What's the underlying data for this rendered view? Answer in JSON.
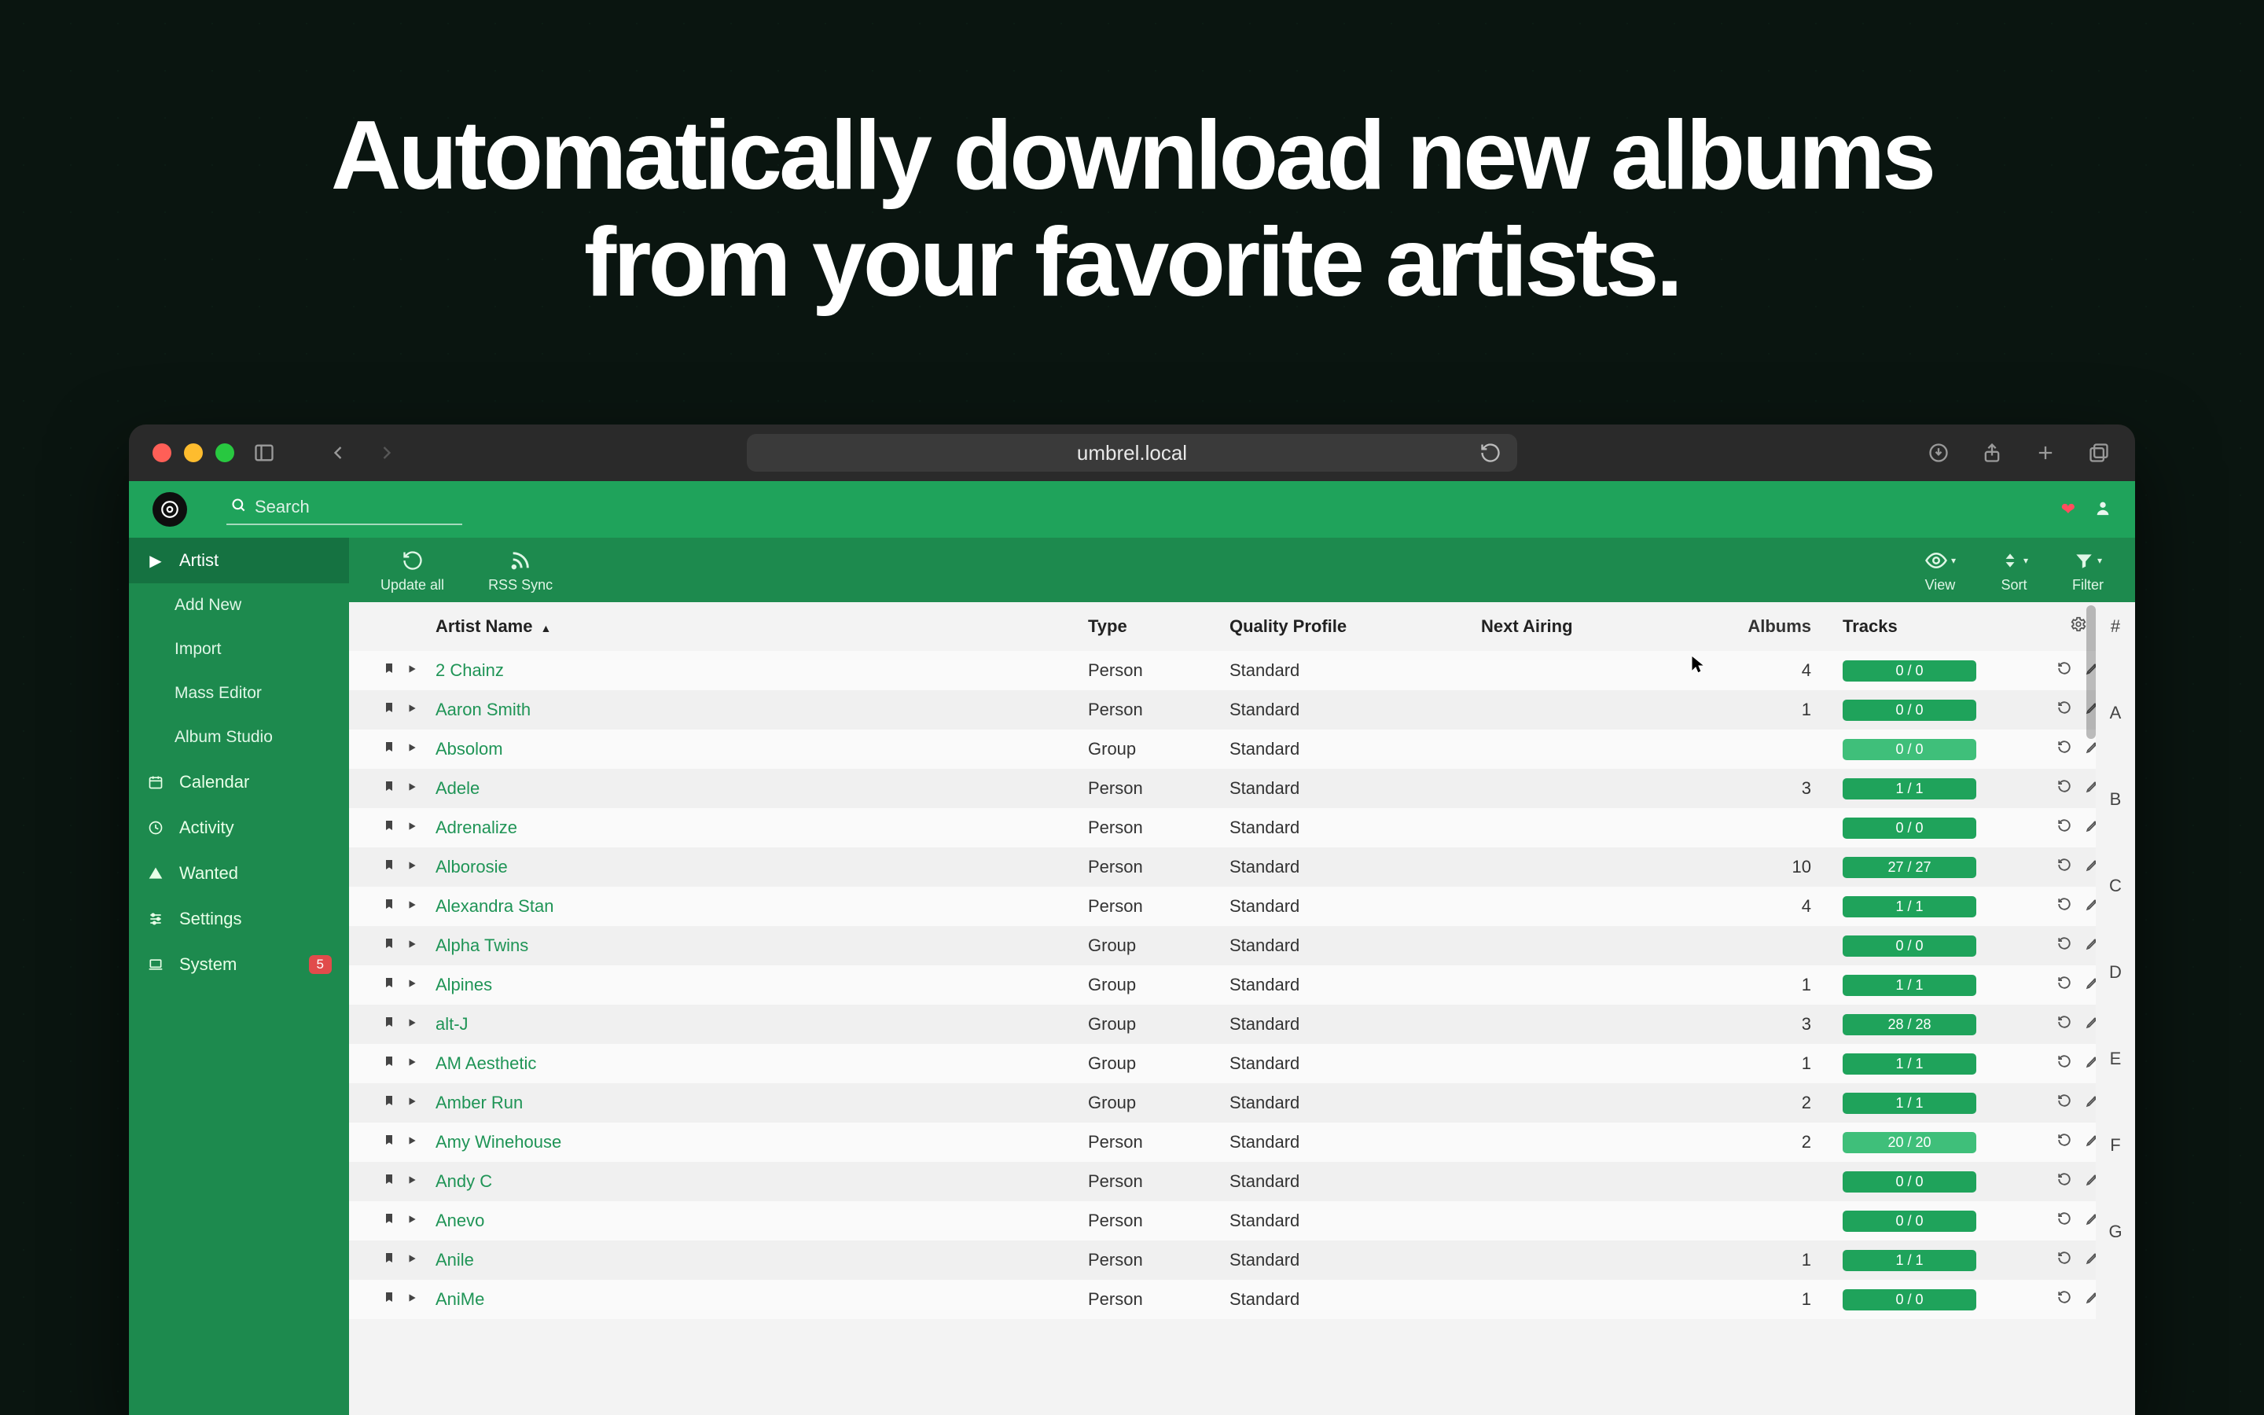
{
  "hero": {
    "line1": "Automatically download new albums",
    "line2": "from your favorite artists."
  },
  "browser": {
    "url": "umbrel.local"
  },
  "header": {
    "search_placeholder": "Search"
  },
  "sidebar": {
    "artist": "Artist",
    "sub": {
      "add_new": "Add New",
      "import": "Import",
      "mass_editor": "Mass Editor",
      "album_studio": "Album Studio"
    },
    "calendar": "Calendar",
    "activity": "Activity",
    "wanted": "Wanted",
    "settings": "Settings",
    "system": "System",
    "system_badge": "5"
  },
  "toolbar": {
    "update_all": "Update all",
    "rss_sync": "RSS Sync",
    "view": "View",
    "sort": "Sort",
    "filter": "Filter"
  },
  "columns": {
    "artist_name": "Artist Name",
    "type": "Type",
    "quality_profile": "Quality Profile",
    "next_airing": "Next Airing",
    "albums": "Albums",
    "tracks": "Tracks"
  },
  "alpha": [
    "#",
    "A",
    "B",
    "C",
    "D",
    "E",
    "F",
    "G"
  ],
  "rows": [
    {
      "name": "2 Chainz",
      "type": "Person",
      "quality": "Standard",
      "albums": "4",
      "tracks": "0 / 0",
      "pill": "std"
    },
    {
      "name": "Aaron Smith",
      "type": "Person",
      "quality": "Standard",
      "albums": "1",
      "tracks": "0 / 0",
      "pill": "std"
    },
    {
      "name": "Absolom",
      "type": "Group",
      "quality": "Standard",
      "albums": "",
      "tracks": "0 / 0",
      "pill": "alt"
    },
    {
      "name": "Adele",
      "type": "Person",
      "quality": "Standard",
      "albums": "3",
      "tracks": "1 / 1",
      "pill": "std"
    },
    {
      "name": "Adrenalize",
      "type": "Person",
      "quality": "Standard",
      "albums": "",
      "tracks": "0 / 0",
      "pill": "std"
    },
    {
      "name": "Alborosie",
      "type": "Person",
      "quality": "Standard",
      "albums": "10",
      "tracks": "27 / 27",
      "pill": "std"
    },
    {
      "name": "Alexandra Stan",
      "type": "Person",
      "quality": "Standard",
      "albums": "4",
      "tracks": "1 / 1",
      "pill": "std"
    },
    {
      "name": "Alpha Twins",
      "type": "Group",
      "quality": "Standard",
      "albums": "",
      "tracks": "0 / 0",
      "pill": "std"
    },
    {
      "name": "Alpines",
      "type": "Group",
      "quality": "Standard",
      "albums": "1",
      "tracks": "1 / 1",
      "pill": "std"
    },
    {
      "name": "alt-J",
      "type": "Group",
      "quality": "Standard",
      "albums": "3",
      "tracks": "28 / 28",
      "pill": "std"
    },
    {
      "name": "AM Aesthetic",
      "type": "Group",
      "quality": "Standard",
      "albums": "1",
      "tracks": "1 / 1",
      "pill": "std"
    },
    {
      "name": "Amber Run",
      "type": "Group",
      "quality": "Standard",
      "albums": "2",
      "tracks": "1 / 1",
      "pill": "std"
    },
    {
      "name": "Amy Winehouse",
      "type": "Person",
      "quality": "Standard",
      "albums": "2",
      "tracks": "20 / 20",
      "pill": "alt"
    },
    {
      "name": "Andy C",
      "type": "Person",
      "quality": "Standard",
      "albums": "",
      "tracks": "0 / 0",
      "pill": "std"
    },
    {
      "name": "Anevo",
      "type": "Person",
      "quality": "Standard",
      "albums": "",
      "tracks": "0 / 0",
      "pill": "std"
    },
    {
      "name": "Anile",
      "type": "Person",
      "quality": "Standard",
      "albums": "1",
      "tracks": "1 / 1",
      "pill": "std"
    },
    {
      "name": "AniMe",
      "type": "Person",
      "quality": "Standard",
      "albums": "1",
      "tracks": "0 / 0",
      "pill": "std"
    }
  ]
}
